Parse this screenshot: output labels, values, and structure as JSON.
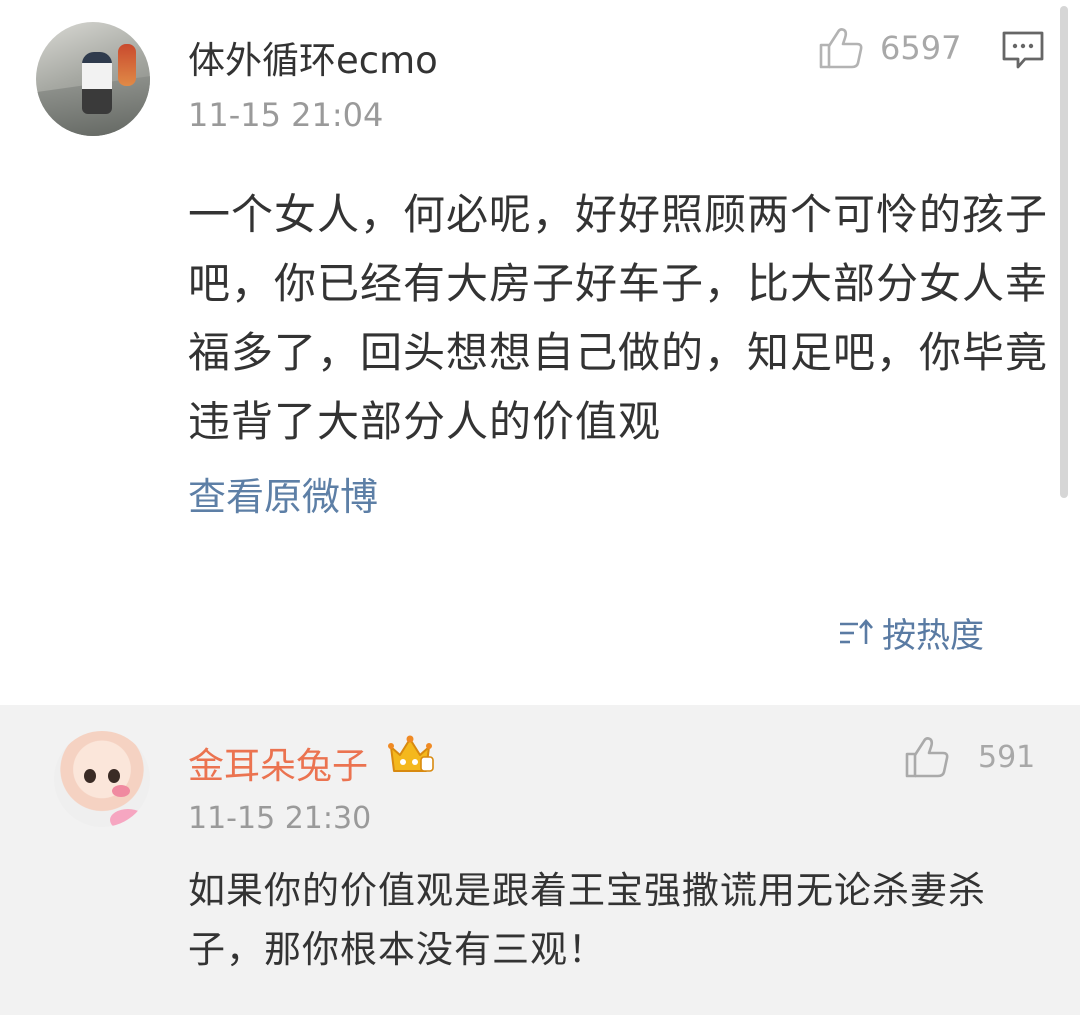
{
  "main_comment": {
    "username": "体外循环ecmo",
    "timestamp": "11-15 21:04",
    "like_count": "6597",
    "body": "一个女人，何必呢，好好照顾两个可怜的孩子吧，你已经有大房子好车子，比大部分女人幸福多了，回头想想自己做的，知足吧，你毕竟违背了大部分人的价值观",
    "view_original_label": "查看原微博",
    "icons": [
      "thumbs-up-icon",
      "comment-icon"
    ]
  },
  "sort": {
    "label": "按热度",
    "icon": "sort-icon"
  },
  "reply": {
    "username": "金耳朵兔子",
    "username_color": "#eb7350",
    "badge_icon": "crown-vip-icon",
    "timestamp": "11-15 21:30",
    "like_count": "591",
    "body": "如果你的价值观是跟着王宝强撒谎用无论杀妻杀子，那你根本没有三观！"
  },
  "colors": {
    "link": "#5d7fa6",
    "text": "#333333",
    "muted": "#9a9a9a",
    "reply_background": "#f2f2f2"
  }
}
